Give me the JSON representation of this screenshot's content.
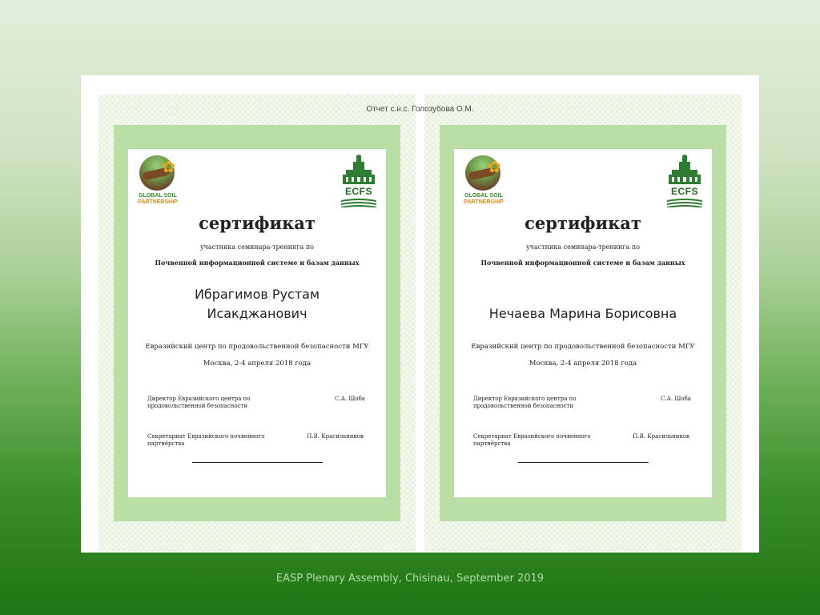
{
  "header": {
    "report_note": "Отчет с.н.с. Голозубова О.М."
  },
  "logos": {
    "gsp_line1": "GLOBAL SOIL",
    "gsp_line2": "PARTNERSHIP",
    "ecfs": "ECFS"
  },
  "certificates": [
    {
      "title": "сертификат",
      "subtitle": "участника семинара-тренинга по",
      "course": "Почвенной информационной системе и базам данных",
      "name": "Ибрагимов Рустам Исакджанович",
      "organization": "Евразийский центр по продовольственной безопасности МГУ",
      "date_place": "Москва, 2-4 апреля 2018 года",
      "signatory1_role": "Директор Евразийского центра по продовольственной безопасности",
      "signatory1_name": "С.А. Шоба",
      "signatory2_role": "Секретариат Евразийского почвенного партнёрства",
      "signatory2_name": "П.В. Красильников"
    },
    {
      "title": "сертификат",
      "subtitle": "участника семинара-тренинга по",
      "course": "Почвенной информационной системе и базам данных",
      "name": "Нечаева Марина Борисовна",
      "organization": "Евразийский центр по продовольственной безопасности МГУ",
      "date_place": "Москва, 2-4 апреля 2018 года",
      "signatory1_role": "Директор Евразийского центра по продовольственной безопасности",
      "signatory1_name": "С.А. Шоба",
      "signatory2_role": "Секретариат Евразийского почвенного партнёрства",
      "signatory2_name": "П.В. Красильников"
    }
  ],
  "footer": {
    "text": "EASP Plenary Assembly, Chisinau, September 2019"
  },
  "colors": {
    "background_top": "#e3eedb",
    "background_bottom": "#1f7413",
    "certificate_border": "#b9dfa6",
    "footer_text": "#b5dda5"
  }
}
